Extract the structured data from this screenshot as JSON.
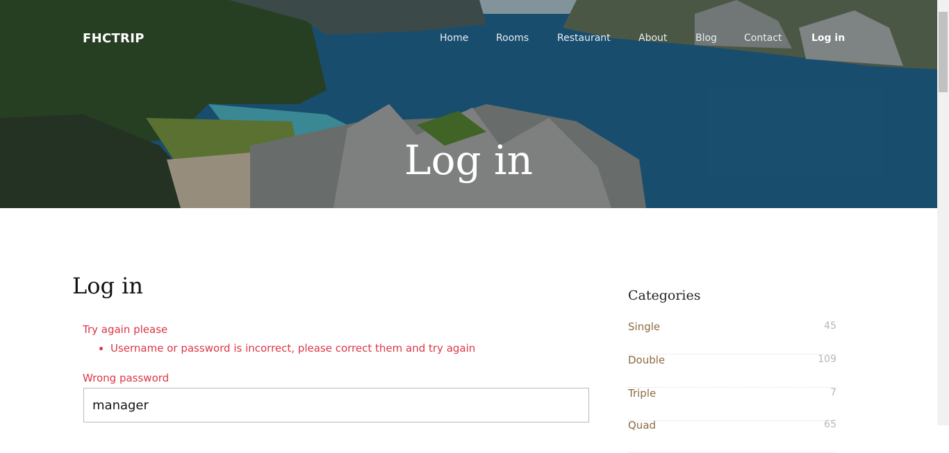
{
  "brand": "FHCTRIP",
  "nav": [
    {
      "label": "Home",
      "active": false
    },
    {
      "label": "Rooms",
      "active": false
    },
    {
      "label": "Restaurant",
      "active": false
    },
    {
      "label": "About",
      "active": false
    },
    {
      "label": "Blog",
      "active": false
    },
    {
      "label": "Contact",
      "active": false
    },
    {
      "label": "Log in",
      "active": true
    }
  ],
  "hero": {
    "title": "Log in"
  },
  "main": {
    "title": "Log in",
    "error_heading": "Try again please",
    "errors": [
      "Username or password is incorrect, please correct them and try again"
    ],
    "password_label": "Wrong password",
    "username_value": "manager"
  },
  "sidebar": {
    "title": "Categories",
    "categories": [
      {
        "name": "Single",
        "count": "45"
      },
      {
        "name": "Double",
        "count": "109"
      },
      {
        "name": "Triple",
        "count": "7"
      },
      {
        "name": "Quad",
        "count": "65"
      }
    ]
  },
  "colors": {
    "error": "#dc3545",
    "category": "#8c6a40",
    "count": "#b5b5b5"
  }
}
